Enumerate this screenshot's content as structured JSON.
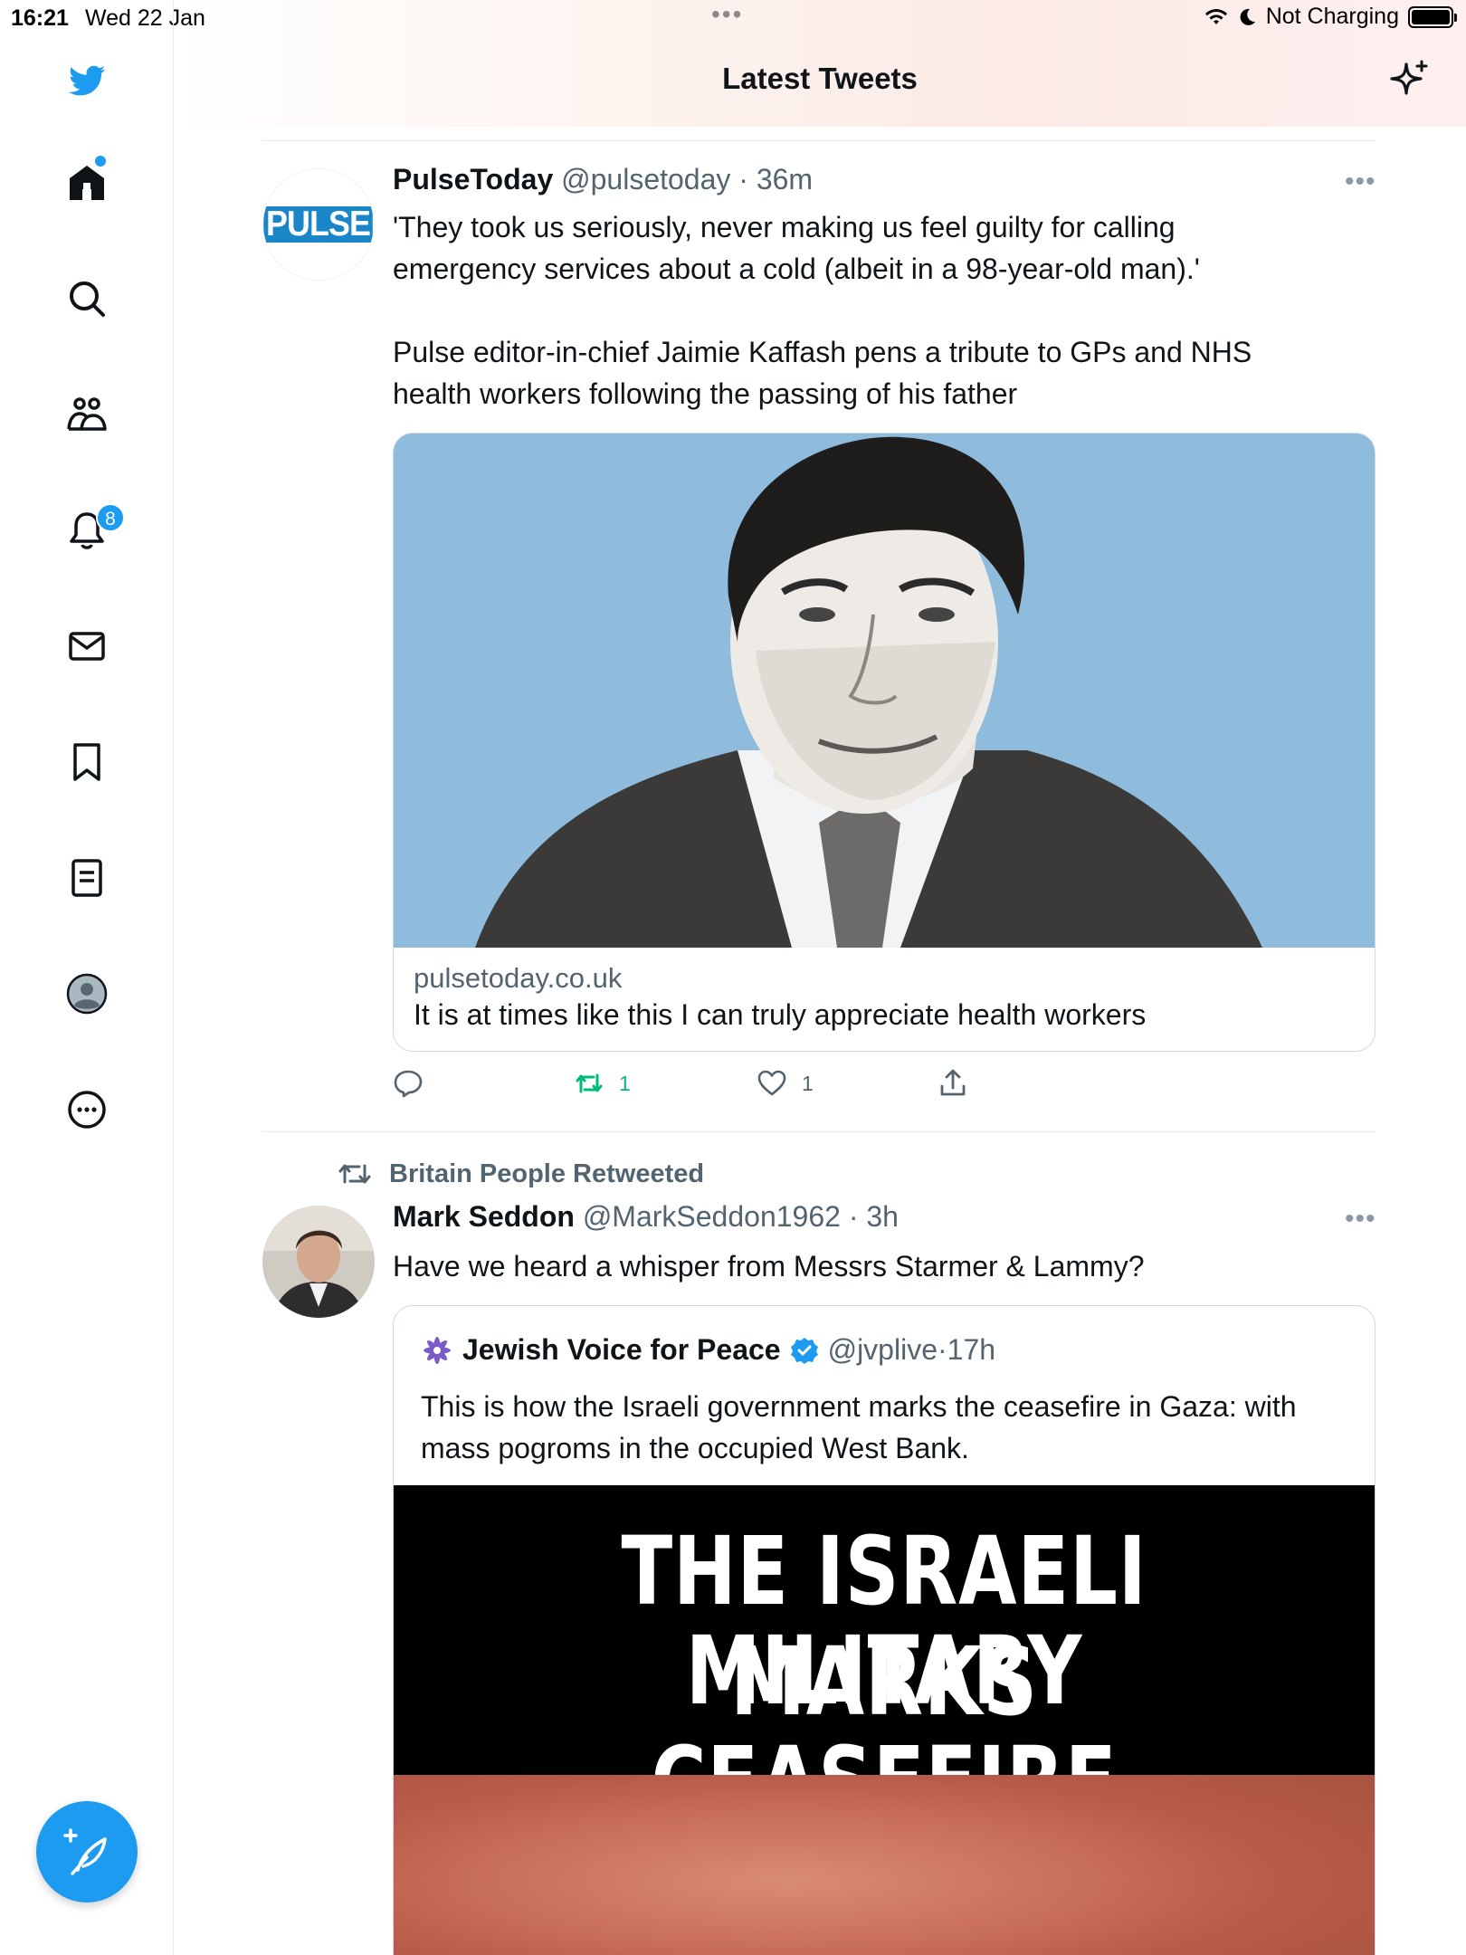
{
  "status_bar": {
    "time": "16:21",
    "date": "Wed 22 Jan",
    "charging": "Not Charging",
    "battery_level": 0.95
  },
  "header": {
    "title": "Latest Tweets",
    "sparkle_icon": "sparkle-icon"
  },
  "sidebar": {
    "items": [
      {
        "icon": "twitter-bird-icon"
      },
      {
        "icon": "home-icon"
      },
      {
        "icon": "search-icon"
      },
      {
        "icon": "communities-icon"
      },
      {
        "icon": "bell-icon",
        "badge": "8"
      },
      {
        "icon": "mail-icon"
      },
      {
        "icon": "bookmark-icon"
      },
      {
        "icon": "lists-icon"
      },
      {
        "icon": "profile-icon"
      },
      {
        "icon": "more-icon"
      }
    ],
    "compose_icon": "compose-icon"
  },
  "tweets": [
    {
      "name": "PulseToday",
      "handle": "@pulsetoday",
      "time": "36m",
      "avatar_text": "PULSE",
      "text_lines": [
        "'They took us seriously, never making us feel guilty for calling",
        "emergency services about a cold (albeit in a 98-year-old man).'",
        "",
        "Pulse editor-in-chief Jaimie Kaffash pens a tribute to GPs and NHS",
        "health workers following the passing of his father"
      ],
      "card": {
        "domain": "pulsetoday.co.uk",
        "title": "It is at times like this I can truly appreciate health workers"
      },
      "actions": {
        "retweets": "1",
        "likes": "1"
      }
    },
    {
      "retweeted_by": "Britain People Retweeted",
      "name": "Mark Seddon",
      "handle": "@MarkSeddon1962",
      "time": "3h",
      "text": "Have we heard a whisper from Messrs Starmer & Lammy?",
      "quote": {
        "name": "Jewish Voice for Peace",
        "handle": "@jvplive",
        "time": "17h",
        "text_lines": [
          "This is how the Israeli government marks the ceasefire in Gaza: with",
          "mass pogroms in the occupied West Bank."
        ],
        "image_line1": "THE ISRAELI MILITARY",
        "image_line2": "MARKS CEASEFIRE"
      }
    }
  ],
  "colors": {
    "accent": "#1d9bf0",
    "retweet_green": "#00ba7c",
    "secondary_text": "#536471"
  }
}
